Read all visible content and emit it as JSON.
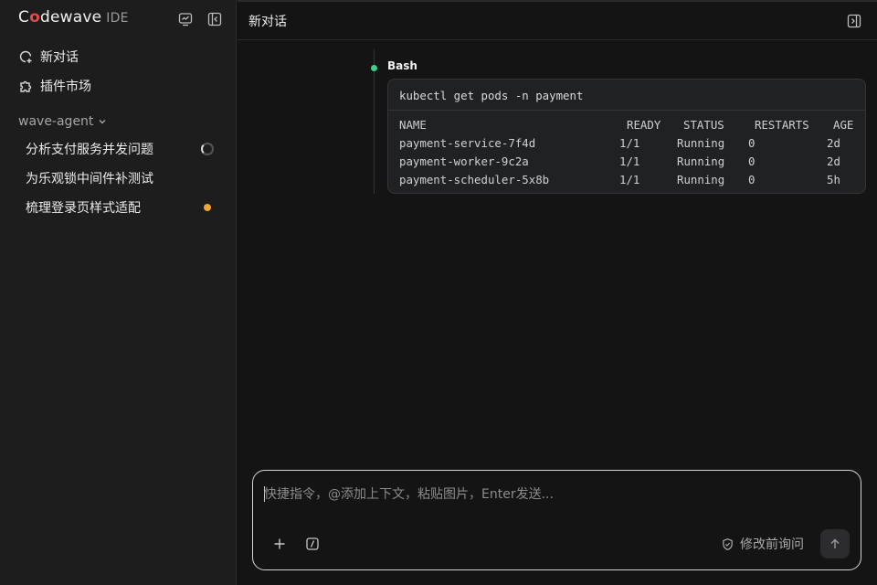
{
  "app": {
    "logo_prefix": "C",
    "logo_o": "o",
    "logo_rest": "dewave",
    "logo_suffix": "IDE"
  },
  "sidebar": {
    "nav": [
      {
        "label": "新对话",
        "icon": "new-chat-icon"
      },
      {
        "label": "插件市场",
        "icon": "puzzle-icon"
      }
    ],
    "project": {
      "label": "wave-agent",
      "icon": "chevron-down-icon"
    },
    "conversations": [
      {
        "label": "分析支付服务并发问题",
        "status": "running"
      },
      {
        "label": "为乐观锁中间件补测试",
        "status": "none"
      },
      {
        "label": "梳理登录页样式适配",
        "status": "unread"
      }
    ]
  },
  "header": {
    "title": "新对话"
  },
  "tool": {
    "name": "Bash",
    "command": "kubectl get pods -n payment",
    "columns": [
      "NAME",
      "READY",
      "STATUS",
      "RESTARTS",
      "AGE"
    ],
    "rows": [
      [
        "payment-service-7f4d",
        "1/1",
        "Running",
        "0",
        "2d"
      ],
      [
        "payment-worker-9c2a",
        "1/1",
        "Running",
        "0",
        "2d"
      ],
      [
        "payment-scheduler-5x8b",
        "1/1",
        "Running",
        "0",
        "5h"
      ]
    ]
  },
  "composer": {
    "placeholder": "快捷指令，@添加上下文，粘贴图片，Enter发送...",
    "ask_label": "修改前询问"
  },
  "colors": {
    "accent_red": "#e5484d",
    "status_green": "#3fcf8e",
    "unread_orange": "#f0a53a"
  }
}
